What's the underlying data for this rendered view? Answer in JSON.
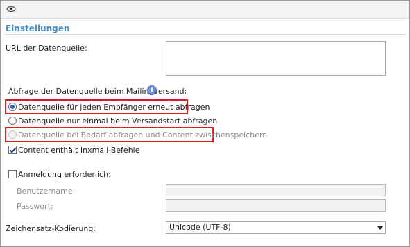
{
  "toolbar": {
    "icon": "eye-icon"
  },
  "section": {
    "title": "Einstellungen"
  },
  "url": {
    "label": "URL der Datenquelle:",
    "value": ""
  },
  "query": {
    "label": "Abfrage der Datenquelle beim Mailingversand:",
    "help_glyph": "i",
    "options": [
      {
        "label": "Datenquelle für jeden Empfänger erneut abfragen",
        "checked": true,
        "disabled": false
      },
      {
        "label": "Datenquelle nur einmal beim Versandstart abfragen",
        "checked": false,
        "disabled": false
      },
      {
        "label": "Datenquelle bei Bedarf abfragen und Content zwischenspeichern",
        "checked": false,
        "disabled": true
      }
    ]
  },
  "inxmail": {
    "label": "Content enthält Inxmail-Befehle",
    "checked": true
  },
  "auth": {
    "label": "Anmeldung erforderlich:",
    "checked": false,
    "username_label": "Benutzername:",
    "password_label": "Passwort:"
  },
  "encoding": {
    "label": "Zeichensatz-Kodierung:",
    "value": "Unicode (UTF-8)"
  },
  "colors": {
    "accent": "#4d8fc5",
    "highlight": "#e21b23"
  }
}
